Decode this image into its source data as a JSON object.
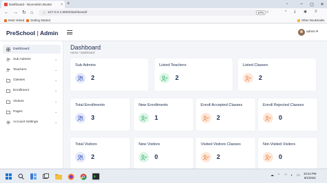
{
  "browser": {
    "tab_title": "Dashboard - NiceAdmin Bootst",
    "tab_close": "×",
    "new_tab": "+",
    "url": "127.0.0.1:8000/dashboard/",
    "zoom": "67%",
    "bookmarks": [
      "Most Visited",
      "Getting Started"
    ],
    "other_bookmarks": "Other Bookmarks"
  },
  "header": {
    "brand_left": "PreSchool",
    "brand_sep": "|",
    "brand_right": "Admin",
    "user": "admin ▾"
  },
  "sidebar": {
    "items": [
      {
        "label": "Dashboard",
        "icon": "grid-icon",
        "active": true,
        "caret": ""
      },
      {
        "label": "Sub Admins",
        "icon": "users-icon",
        "active": false,
        "caret": "⌄"
      },
      {
        "label": "Teachers",
        "icon": "users-icon",
        "active": false,
        "caret": "⌄"
      },
      {
        "label": "Classes",
        "icon": "folder-icon",
        "active": false,
        "caret": "⌄"
      },
      {
        "label": "Enrollment",
        "icon": "folder-icon",
        "active": false,
        "caret": "⌄"
      },
      {
        "label": "Visitors",
        "icon": "folder-icon",
        "active": false,
        "caret": "⌄"
      },
      {
        "label": "Pages",
        "icon": "folder-icon",
        "active": false,
        "caret": "⌄"
      },
      {
        "label": "Account Settings",
        "icon": "gear-icon",
        "active": false,
        "caret": "⌄"
      }
    ]
  },
  "main": {
    "title": "Dashboard",
    "breadcrumb": "Home  /  Dashboard",
    "cards": [
      {
        "title": "Sub Admins",
        "value": "2",
        "icon": "users-icon",
        "color": "blue"
      },
      {
        "title": "Listed Teachers",
        "value": "2",
        "icon": "user-check-icon",
        "color": "green"
      },
      {
        "title": "Listed Classes",
        "value": "2",
        "icon": "user-check-icon",
        "color": "orange"
      },
      {
        "title": "Total Enrollments",
        "value": "3",
        "icon": "users-icon",
        "color": "blue"
      },
      {
        "title": "New Enrollments",
        "value": "1",
        "icon": "user-check-icon",
        "color": "green"
      },
      {
        "title": "Enroll Accepted Classes",
        "value": "2",
        "icon": "user-check-icon",
        "color": "orange"
      },
      {
        "title": "Enroll Rejected Classes",
        "value": "0",
        "icon": "user-check-icon",
        "color": "orange"
      },
      {
        "title": "Total Visitors",
        "value": "2",
        "icon": "users-icon",
        "color": "blue"
      },
      {
        "title": "New Visitors",
        "value": "0",
        "icon": "user-check-icon",
        "color": "green"
      },
      {
        "title": "Visited Visitors Classes",
        "value": "2",
        "icon": "user-check-icon",
        "color": "orange"
      },
      {
        "title": "Not-Visited Visitors",
        "value": "0",
        "icon": "user-check-icon",
        "color": "orange"
      }
    ]
  },
  "taskbar": {
    "time": "10:24 PM",
    "date": "5/1/2023",
    "weather": "☁"
  },
  "colors": {
    "brand": "#1b2a4e",
    "accent_red": "#e2483d",
    "blue": "#4a63c8",
    "green": "#2fb36b",
    "orange": "#ee7d3b"
  }
}
